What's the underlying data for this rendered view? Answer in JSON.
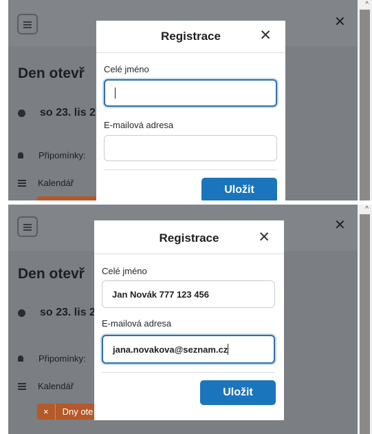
{
  "screens": [
    {
      "event_title": "Den otevř",
      "date": "so 23. lis 2",
      "reminders_label": "Připomínky:",
      "calendar_label": "Kalendář",
      "modal": {
        "title": "Registrace",
        "close": "✕",
        "name_label": "Celé jméno",
        "name_value": "",
        "email_label": "E-mailová adresa",
        "email_value": "",
        "save_label": "Uložit",
        "focused_field": "name"
      }
    },
    {
      "event_title": "Den otevř",
      "date": "so 23. lis 2",
      "reminders_label": "Připomínky:",
      "calendar_label": "Kalendář",
      "tag": {
        "remove": "×",
        "label": "Dny ote"
      },
      "modal": {
        "title": "Registrace",
        "close": "✕",
        "name_label": "Celé jméno",
        "name_value": "Jan Novák 777 123 456",
        "email_label": "E-mailová adresa",
        "email_value": "jana.novakova@seznam.cz",
        "save_label": "Uložit",
        "focused_field": "email"
      }
    }
  ],
  "app_close": "✕",
  "scroll_up": "^",
  "colors": {
    "primary": "#1b75bc",
    "focus_border": "#2f6fa8",
    "overlay": "#7b7e82",
    "tag": "#b4592a"
  }
}
